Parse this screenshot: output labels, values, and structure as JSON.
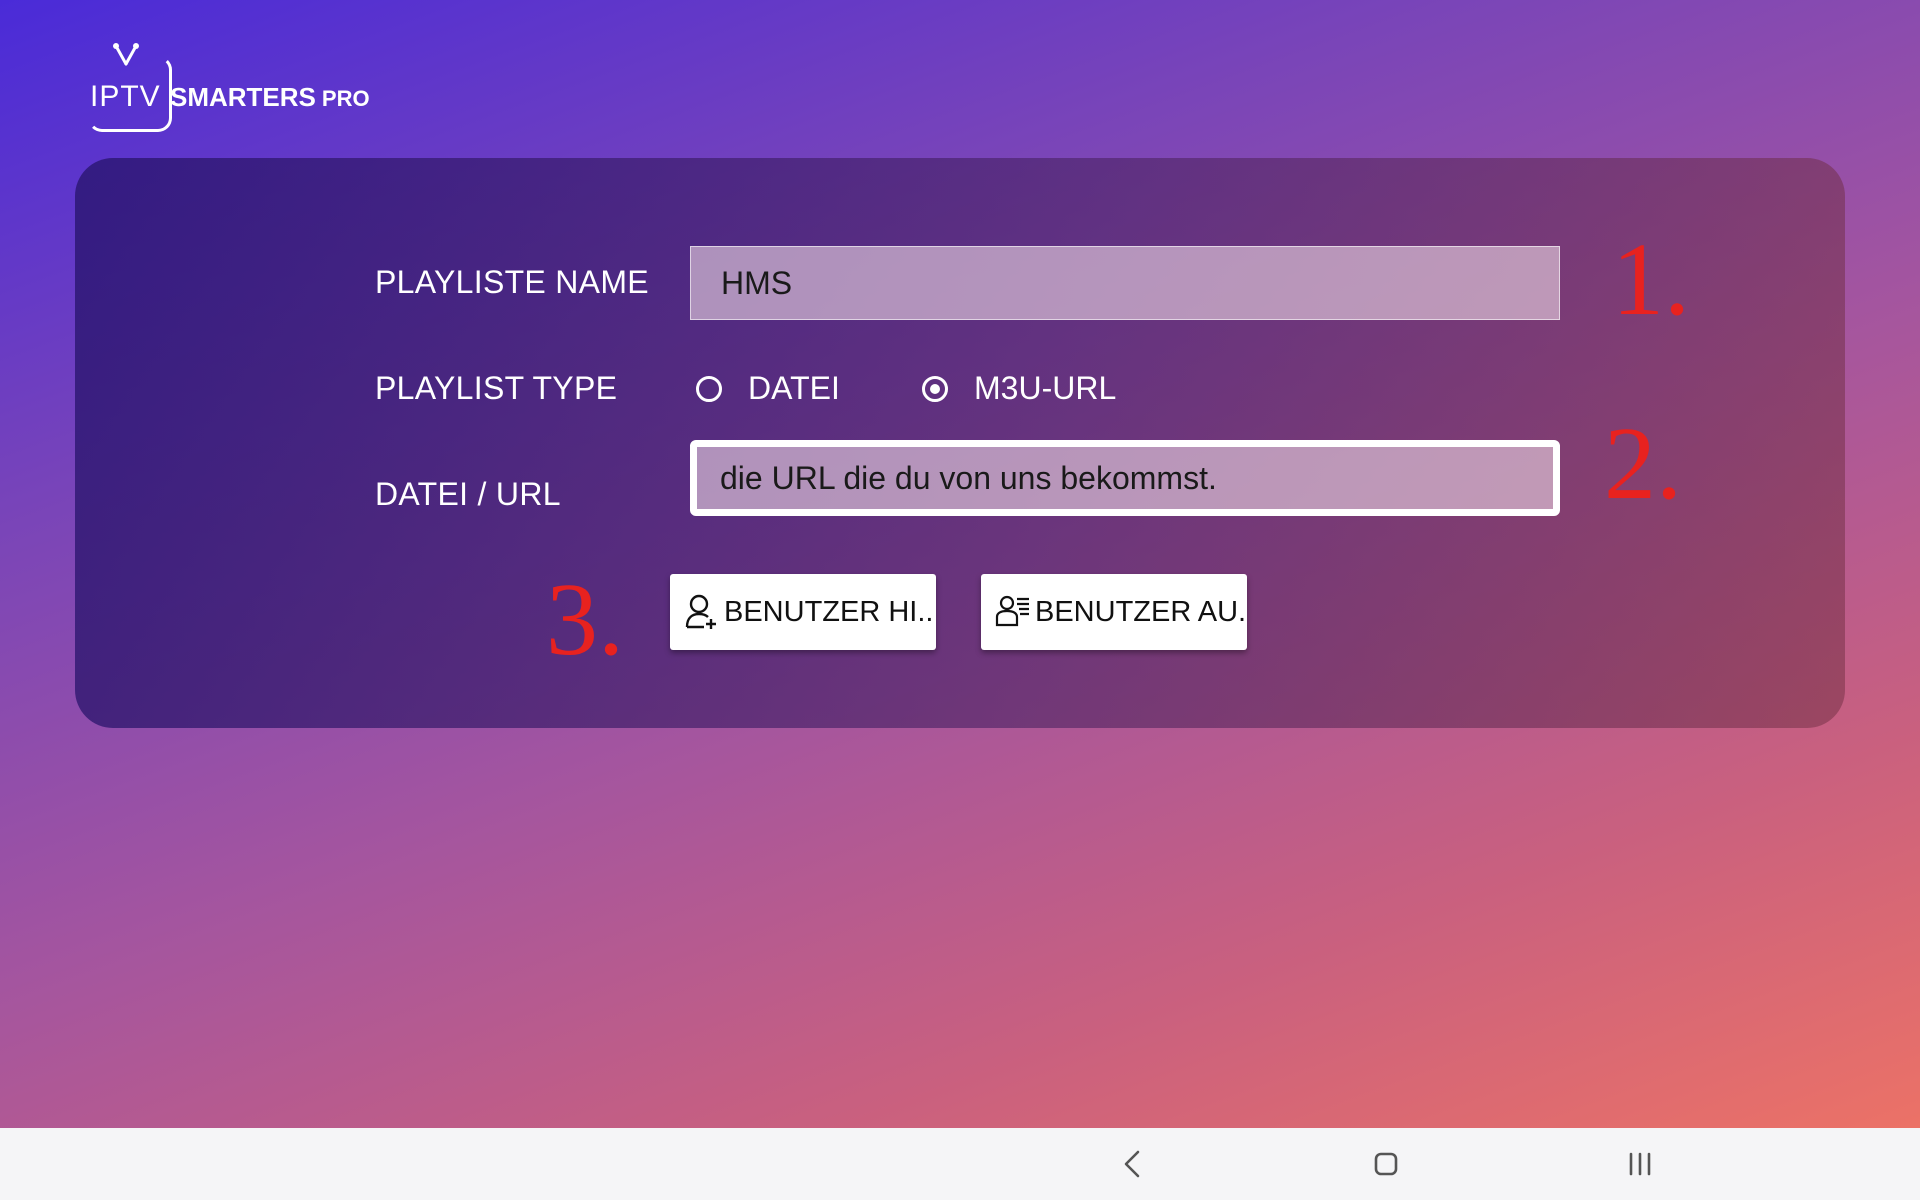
{
  "app": {
    "logo_iptv": "IPTV",
    "logo_smarters": "SMARTERS",
    "logo_pro": "PRO"
  },
  "form": {
    "playlist_name_label": "PLAYLISTE NAME",
    "playlist_name_value": "HMS",
    "playlist_type_label": "PLAYLIST TYPE",
    "type_options": [
      {
        "label": "DATEI",
        "selected": false
      },
      {
        "label": "M3U-URL",
        "selected": true
      }
    ],
    "file_url_label": "DATEI / URL",
    "file_url_value": "die URL die du von uns bekommst."
  },
  "buttons": {
    "add_user": "BENUTZER HI..",
    "list_users": "BENUTZER AU.."
  },
  "annotations": {
    "step1": "1.",
    "step2": "2.",
    "step3": "3."
  },
  "colors": {
    "annotation": "#e8221f",
    "card_bg": "rgba(40,20,110,0.78)"
  },
  "navbar": {
    "icons": [
      "back-icon",
      "home-icon",
      "recents-icon"
    ]
  }
}
